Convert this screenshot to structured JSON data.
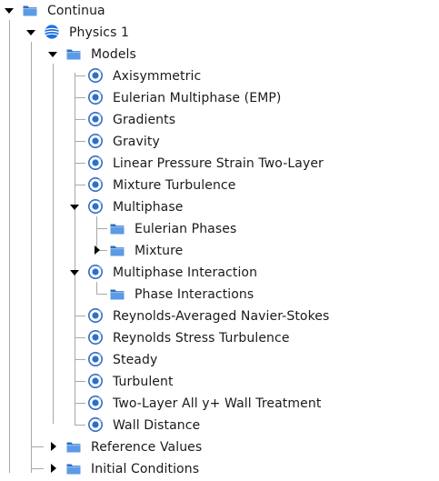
{
  "tree": {
    "continua": "Continua",
    "physics1": "Physics 1",
    "models": "Models",
    "axisymmetric": "Axisymmetric",
    "emp": "Eulerian Multiphase (EMP)",
    "gradients": "Gradients",
    "gravity": "Gravity",
    "lpsTwoLayer": "Linear Pressure Strain Two-Layer",
    "mixtureTurbulence": "Mixture Turbulence",
    "multiphase": "Multiphase",
    "eulerianPhases": "Eulerian Phases",
    "mixture": "Mixture",
    "multiphaseInteraction": "Multiphase Interaction",
    "phaseInteractions": "Phase Interactions",
    "rans": "Reynolds-Averaged Navier-Stokes",
    "rst": "Reynolds Stress Turbulence",
    "steady": "Steady",
    "turbulent": "Turbulent",
    "twoLayerWall": "Two-Layer All y+ Wall Treatment",
    "wallDistance": "Wall Distance",
    "referenceValues": "Reference Values",
    "initialConditions": "Initial Conditions"
  },
  "colors": {
    "folder": "#3f7fd1",
    "model": "#2f6fc5",
    "physics": "#1f6fe0",
    "treeLine": "#a8a8a8"
  }
}
